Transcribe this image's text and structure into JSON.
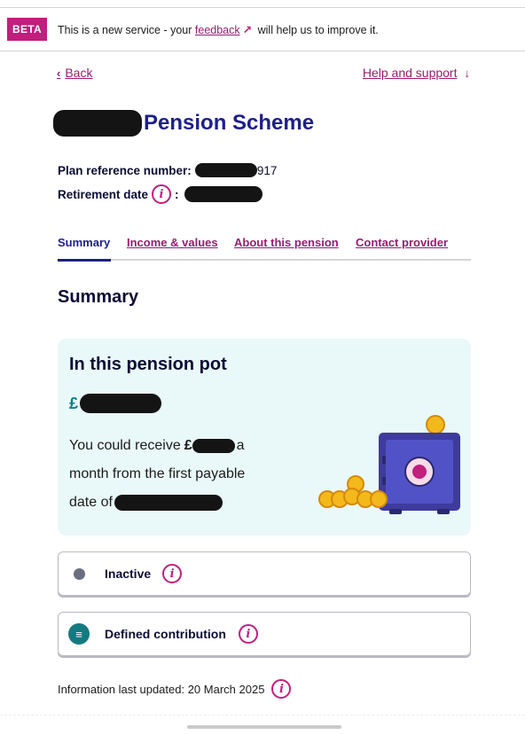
{
  "banner": {
    "tag": "BETA",
    "text_before": "This is a new service - your",
    "link": "feedback",
    "text_after": "will help us to improve it."
  },
  "nav": {
    "back": "Back",
    "help": "Help and support"
  },
  "header": {
    "title": "Pension Scheme",
    "plan_ref_label": "Plan reference number:",
    "plan_ref_suffix": "917",
    "retirement_label": "Retirement date",
    "colon": ":"
  },
  "tabs": [
    {
      "label": "Summary",
      "active": true
    },
    {
      "label": "Income & values",
      "active": false
    },
    {
      "label": "About this pension",
      "active": false
    },
    {
      "label": "Contact provider",
      "active": false
    }
  ],
  "section_title": "Summary",
  "pot": {
    "title": "In this pension pot",
    "currency": "£",
    "line1_before": "You could receive",
    "line1_currency": "£",
    "line1_after": "a",
    "line2": "month from the first payable",
    "line3_before": "date of"
  },
  "status": {
    "inactive": "Inactive",
    "type": "Defined contribution"
  },
  "updated": "Information last updated: 20 March 2025",
  "colors": {
    "accent_magenta": "#c01f7d",
    "title_blue": "#1d1f8c",
    "teal": "#137a82",
    "card_bg": "#e9f8f8"
  }
}
